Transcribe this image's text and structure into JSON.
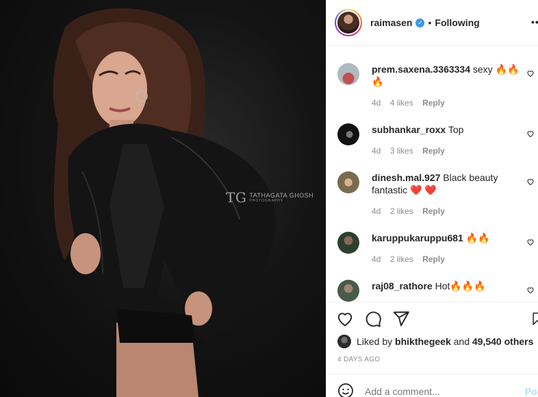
{
  "post": {
    "author": "raimasen",
    "separator": "•",
    "follow_state": "Following",
    "more": "•••",
    "verified_mark": "✓",
    "photo_watermark": "TATHAGATA GHOSH",
    "photo_watermark_sub": "PHOTOGRAPHY",
    "photo_watermark_mark": "TG"
  },
  "comments": [
    {
      "user": "prem.saxena.3363334",
      "text": "sexy 🔥🔥🔥",
      "age": "4d",
      "likes": "4 likes",
      "reply": "Reply",
      "avatar_color": "#9c6f5f"
    },
    {
      "user": "subhankar_roxx",
      "text": "Top",
      "age": "4d",
      "likes": "3 likes",
      "reply": "Reply",
      "avatar_color": "#1b1b1b"
    },
    {
      "user": "dinesh.mal.927",
      "text": "Black beauty fantastic ❤️ ❤️",
      "age": "4d",
      "likes": "2 likes",
      "reply": "Reply",
      "avatar_color": "#8a7a60"
    },
    {
      "user": "karuppukaruppu681",
      "text": "🔥🔥",
      "age": "4d",
      "likes": "2 likes",
      "reply": "Reply",
      "avatar_color": "#3a4a3a"
    },
    {
      "user": "raj08_rathore",
      "text": "Hot🔥🔥🔥",
      "age": "",
      "likes": "",
      "reply": "",
      "avatar_color": "#5a6a5a"
    }
  ],
  "likes": {
    "prefix": "Liked by",
    "user": "bhikthegeek",
    "connector": "and",
    "others": "49,540 others"
  },
  "timestamp": "4 DAYS AGO",
  "add_comment": {
    "placeholder": "Add a comment...",
    "post_label": "Post"
  },
  "colors": {
    "accent_blue": "#3897f0",
    "post_disabled": "#b2dffc",
    "meta_grey": "#8e8e8e"
  }
}
